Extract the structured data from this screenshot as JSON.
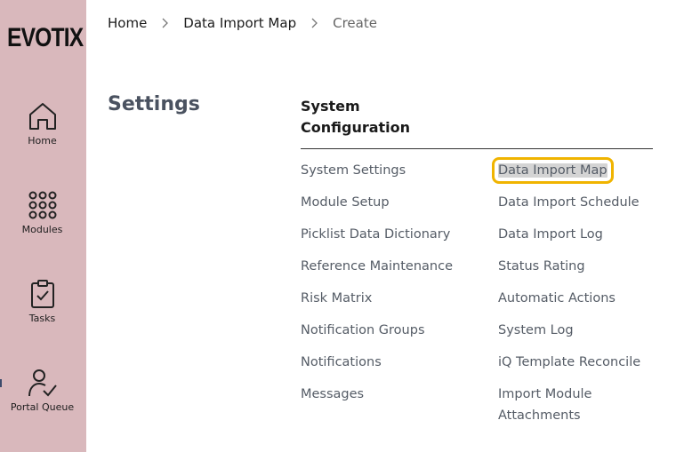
{
  "brand": {
    "logo_text": "EVOTIX"
  },
  "sidebar": {
    "items": [
      {
        "label": "Home",
        "icon": "home-icon"
      },
      {
        "label": "Modules",
        "icon": "grid-icon"
      },
      {
        "label": "Tasks",
        "icon": "clipboard-check-icon"
      },
      {
        "label": "Portal Queue",
        "icon": "user-check-icon"
      }
    ]
  },
  "breadcrumb": [
    {
      "label": "Home"
    },
    {
      "label": "Data Import Map"
    },
    {
      "label": "Create"
    }
  ],
  "page": {
    "title": "Settings"
  },
  "section": {
    "title": "System Configuration",
    "left_links": [
      "System Settings",
      "Module Setup",
      "Picklist Data Dictionary",
      "Reference Maintenance",
      "Risk Matrix",
      "Notification Groups",
      "Notifications",
      "Messages"
    ],
    "right_links": [
      "Data Import Map",
      "Data Import Schedule",
      "Data Import Log",
      "Status Rating",
      "Automatic Actions",
      "System Log",
      "iQ Template Reconcile",
      "Import Module Attachments"
    ]
  },
  "colors": {
    "sidebar_bg": "#d9b8bc",
    "highlight_outline": "#f0b400"
  }
}
